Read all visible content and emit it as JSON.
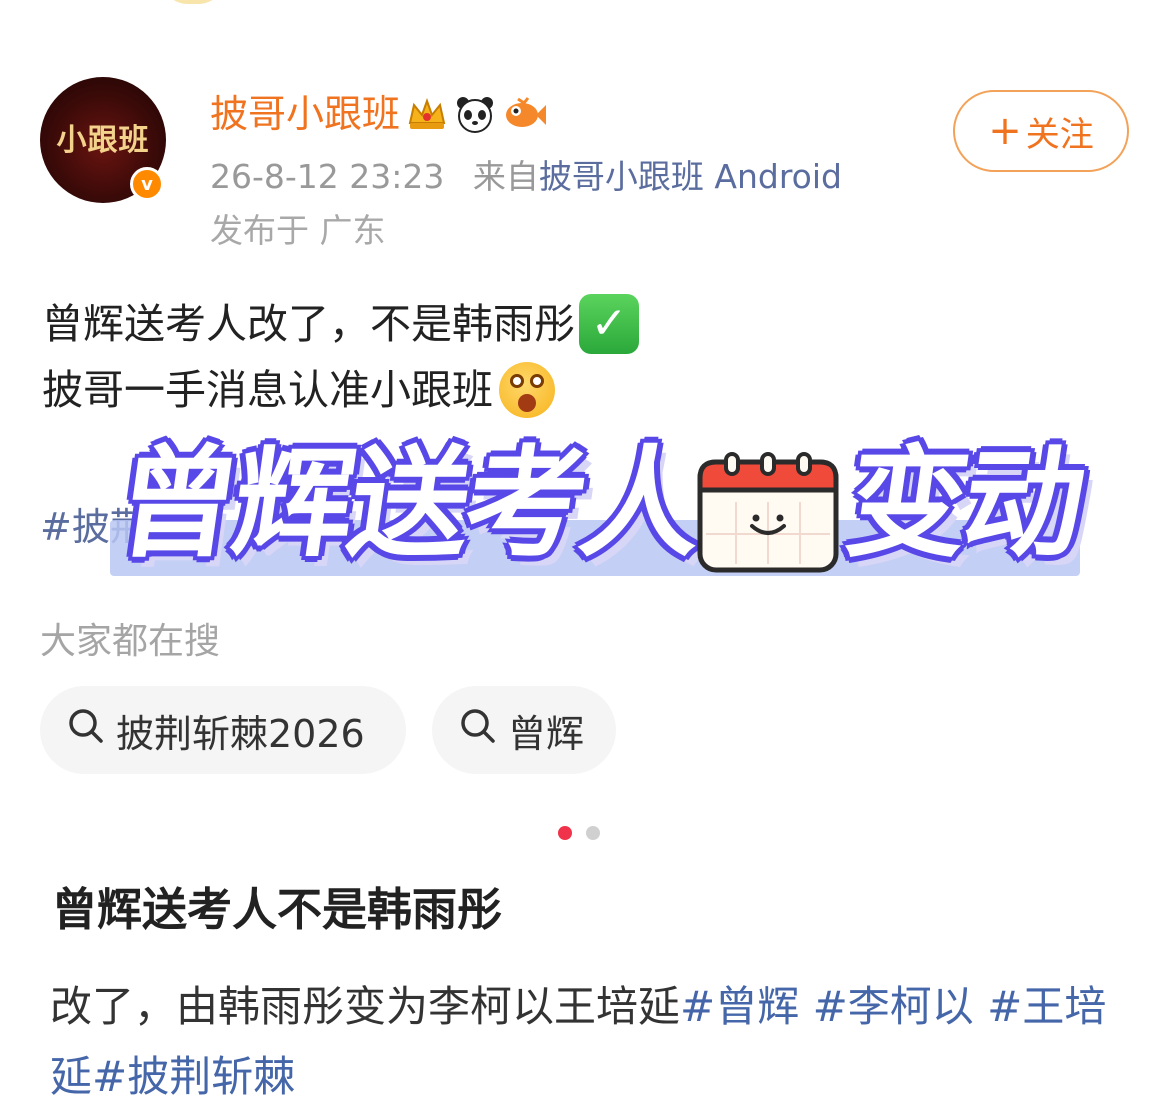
{
  "post": {
    "username": "披哥小跟班",
    "user_badges": [
      "crown-icon",
      "panda-icon",
      "fish-icon"
    ],
    "avatar_text": "小跟班",
    "verified_mark": "v",
    "timestamp": "26-8-12 23:23",
    "source_prefix": "来自",
    "source": "披哥小跟班 Android",
    "location": "发布于 广东",
    "follow_label": "关注",
    "follow_plus": "+",
    "text_line1": "曾辉送考人改了，不是韩雨彤",
    "text_line2": "披哥一手消息认准小跟班",
    "hashtag_partial": "#披荆",
    "check_emoji": "✓"
  },
  "banner": {
    "title_part1": "曾辉送考人",
    "title_part2": "变动"
  },
  "search": {
    "label": "大家都在搜",
    "chips": [
      "披荆斩棘2026",
      "曾辉"
    ]
  },
  "pager": {
    "active_color": "#f0334a",
    "inactive_color": "#d0d0d0"
  },
  "card": {
    "title": "曾辉送考人不是韩雨彤",
    "body_text": "改了，由韩雨彤变为李柯以王培延",
    "tags": [
      "#曾辉",
      "#李柯以",
      "#王培延",
      "#披荆斩棘"
    ]
  },
  "colors": {
    "accent_orange": "#f0731f",
    "link_blue": "#5a6d9e",
    "banner_purple": "#5848e8"
  }
}
